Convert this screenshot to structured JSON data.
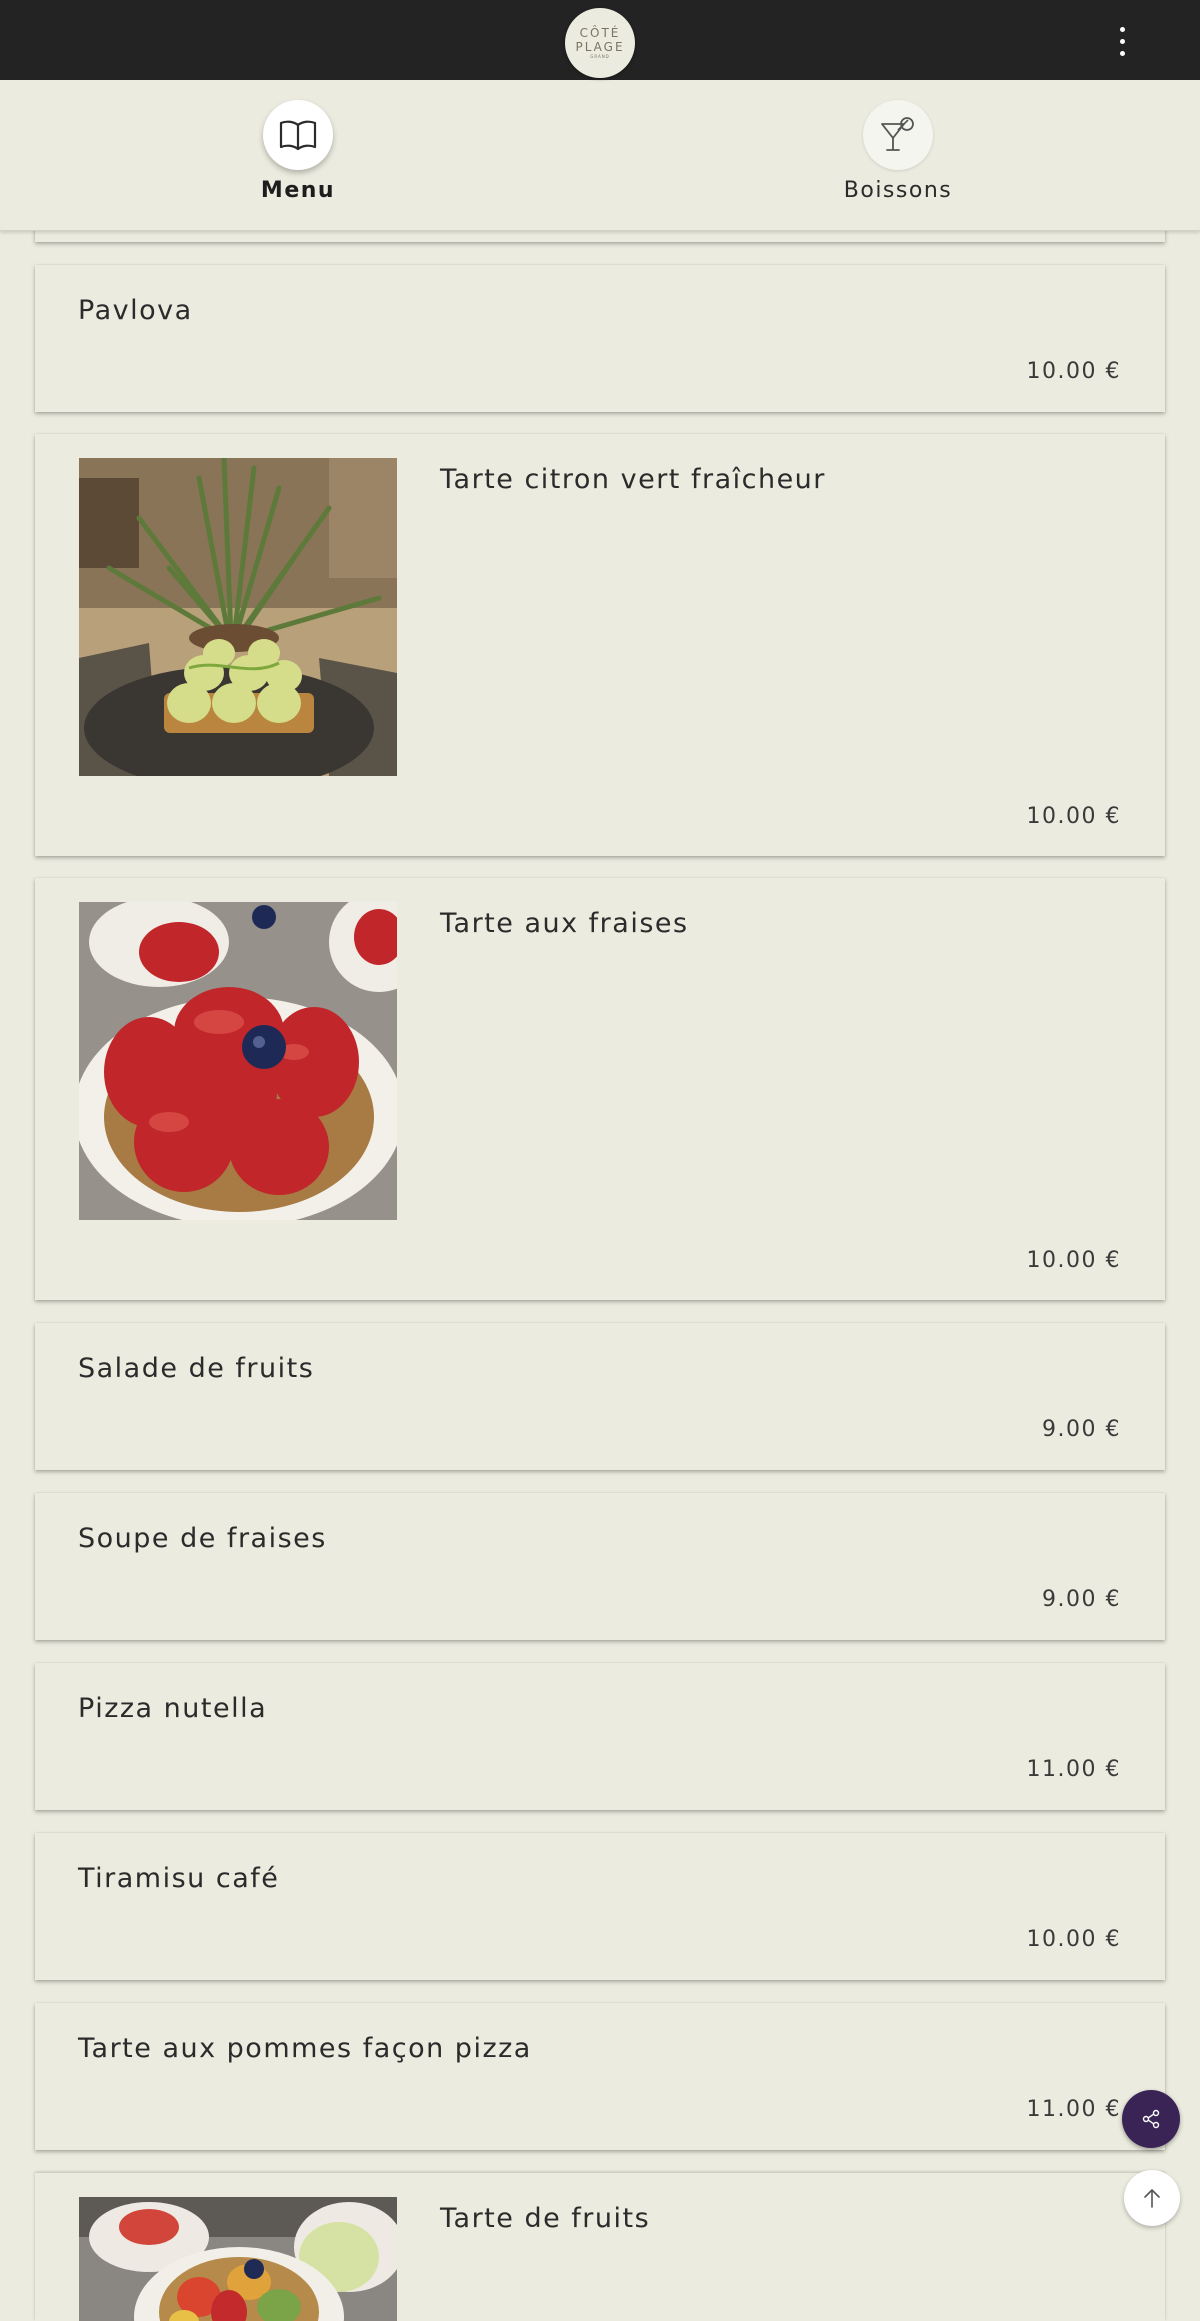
{
  "header": {
    "logo": {
      "line1": "CÔTÉ",
      "line2": "PLAGE",
      "line3": "GRAND"
    },
    "menu_icon": "more-vertical-icon"
  },
  "tabs": [
    {
      "label": "Menu",
      "icon": "book-open-icon",
      "active": true
    },
    {
      "label": "Boissons",
      "icon": "cocktail-glass-icon",
      "active": false
    }
  ],
  "items": [
    {
      "name": "",
      "price": ""
    },
    {
      "name": "Pavlova",
      "price": "10.00 €"
    },
    {
      "name": "Tarte citron vert fraîcheur",
      "price": "10.00 €",
      "photo": "lime-tart-photo"
    },
    {
      "name": "Tarte aux fraises",
      "price": "10.00 €",
      "photo": "strawberry-tart-photo"
    },
    {
      "name": "Salade de fruits",
      "price": "9.00 €"
    },
    {
      "name": "Soupe de fraises",
      "price": "9.00 €"
    },
    {
      "name": "Pizza nutella",
      "price": "11.00 €"
    },
    {
      "name": "Tiramisu café",
      "price": "10.00 €"
    },
    {
      "name": "Tarte aux pommes façon pizza",
      "price": "11.00 €"
    },
    {
      "name": "Tarte de fruits",
      "price": "",
      "photo": "fruit-tarts-photo"
    }
  ],
  "fabs": {
    "share_icon": "share-icon",
    "top_icon": "arrow-up-icon"
  },
  "colors": {
    "background": "#ecebdf",
    "topbar": "#232323",
    "share_button": "#3a2456"
  }
}
